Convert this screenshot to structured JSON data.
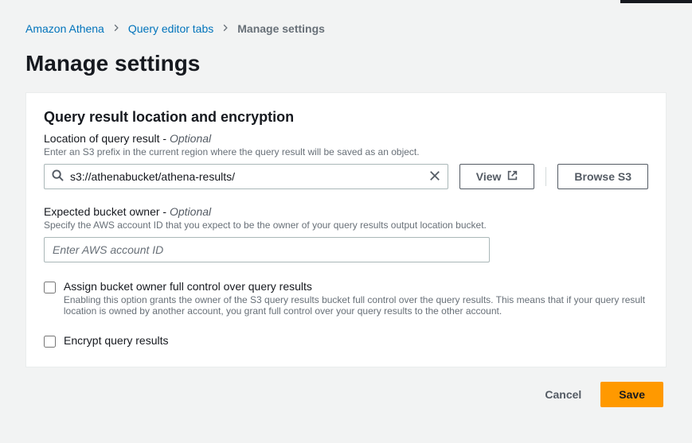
{
  "breadcrumb": {
    "items": [
      {
        "label": "Amazon Athena"
      },
      {
        "label": "Query editor tabs"
      }
    ],
    "current": "Manage settings"
  },
  "page_title": "Manage settings",
  "section": {
    "title": "Query result location and encryption",
    "location": {
      "label": "Location of query result - ",
      "optional": "Optional",
      "desc": "Enter an S3 prefix in the current region where the query result will be saved as an object.",
      "value": "s3://athenabucket/athena-results/",
      "view_btn": "View",
      "browse_btn": "Browse S3"
    },
    "owner": {
      "label": "Expected bucket owner - ",
      "optional": "Optional",
      "desc": "Specify the AWS account ID that you expect to be the owner of your query results output location bucket.",
      "placeholder": "Enter AWS account ID"
    },
    "assign_control": {
      "label": "Assign bucket owner full control over query results",
      "desc": "Enabling this option grants the owner of the S3 query results bucket full control over the query results. This means that if your query result location is owned by another account, you grant full control over your query results to the other account."
    },
    "encrypt": {
      "label": "Encrypt query results"
    }
  },
  "footer": {
    "cancel": "Cancel",
    "save": "Save"
  }
}
